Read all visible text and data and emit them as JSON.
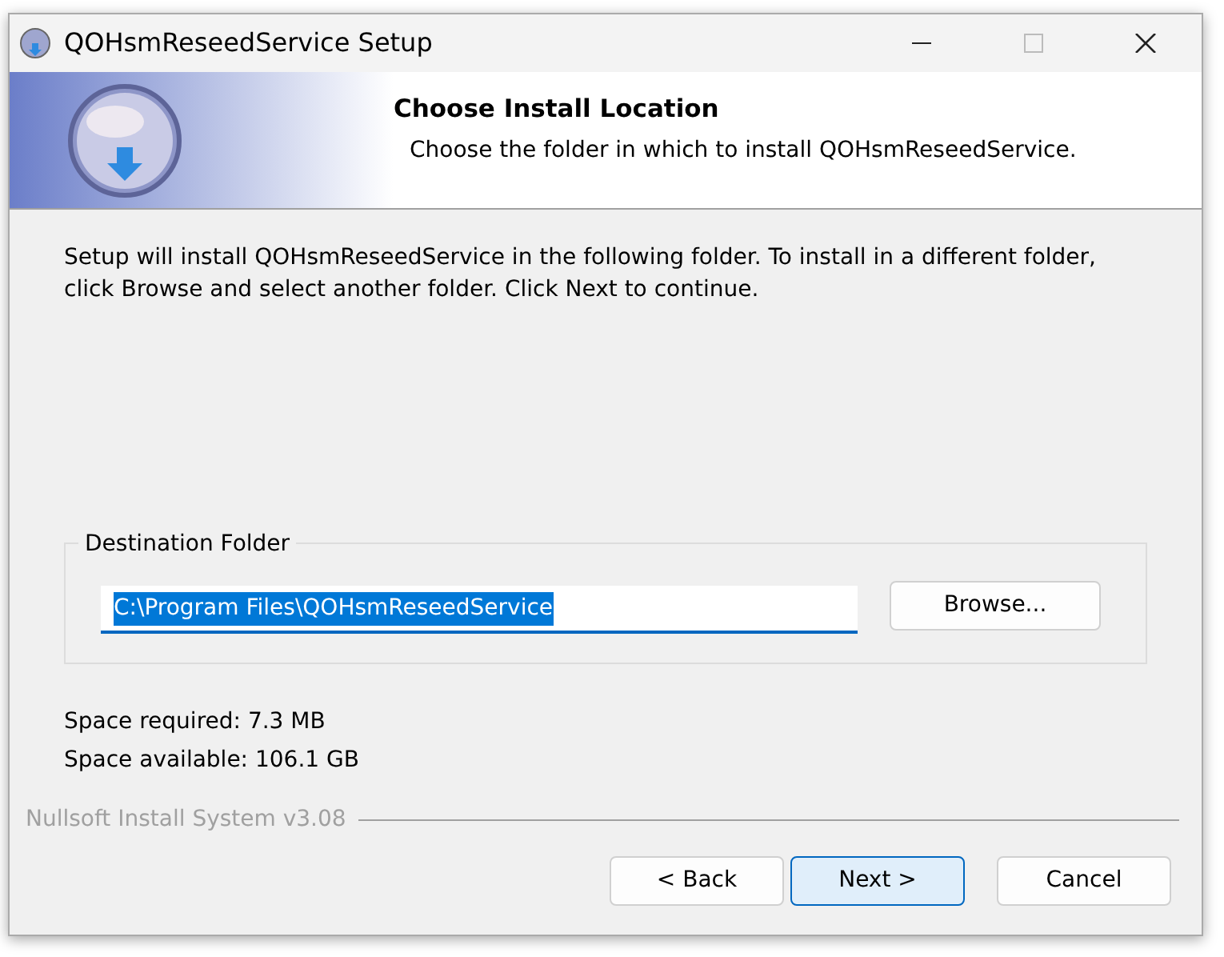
{
  "window": {
    "title": "QOHsmReseedService Setup"
  },
  "header": {
    "title": "Choose Install Location",
    "subtitle": "Choose the folder in which to install QOHsmReseedService."
  },
  "intro": "Setup will install QOHsmReseedService in the following folder. To install in a different folder, click Browse and select another folder. Click Next to continue.",
  "destination": {
    "label": "Destination Folder",
    "value": "C:\\Program Files\\QOHsmReseedService",
    "text_selected": true,
    "browse": "Browse..."
  },
  "space": [
    "Space required: 7.3 MB",
    "Space available: 106.1 GB"
  ],
  "branding": "Nullsoft Install System v3.08",
  "buttons": [
    {
      "label": "< Back",
      "default": false
    },
    {
      "label": "Next >",
      "default": true
    },
    {
      "label": "Cancel",
      "default": false
    }
  ]
}
